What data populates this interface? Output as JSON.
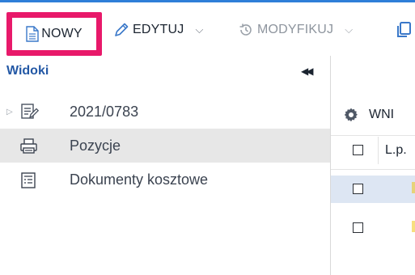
{
  "toolbar": {
    "new_label": "NOWY",
    "edit_label": "EDYTUJ",
    "modify_label": "MODYFIKUJ",
    "dropdown_icon": "chevron-down-icon"
  },
  "sidebar": {
    "title": "Widoki",
    "items": [
      {
        "label": "2021/0783",
        "icon": "document-edit-icon"
      },
      {
        "label": "Pozycje",
        "icon": "printer-icon"
      },
      {
        "label": "Dokumenty kosztowe",
        "icon": "receipt-icon"
      }
    ]
  },
  "grid": {
    "title": "WNI",
    "column_lp": "L.p."
  },
  "colors": {
    "accent": "#2358a5",
    "highlight_border": "#e8196a",
    "selected_row": "#dde6f3",
    "active_item": "#e7e7e7"
  }
}
